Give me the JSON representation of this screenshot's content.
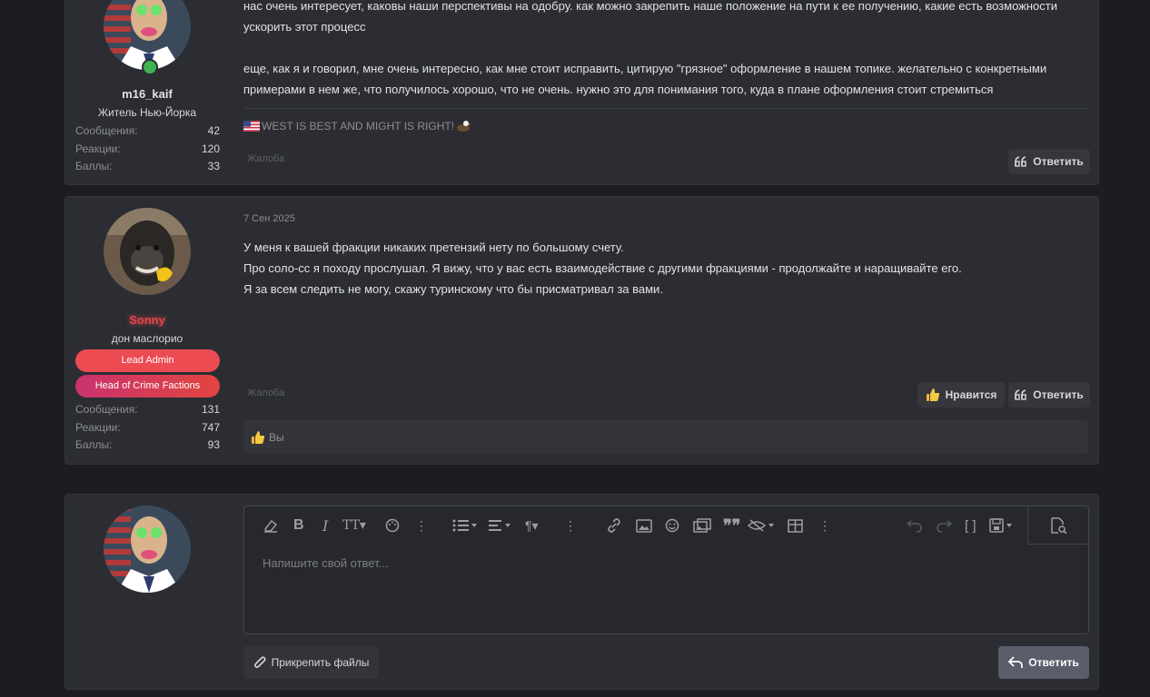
{
  "posts": [
    {
      "username": "m16_kaif",
      "user_title": "Житель Нью-Йорка",
      "stats": [
        {
          "label": "Сообщения:",
          "value": "42"
        },
        {
          "label": "Реакции:",
          "value": "120"
        },
        {
          "label": "Баллы:",
          "value": "33"
        }
      ],
      "lines": [
        "нас очень интересует, каковы наши перспективы на одобру. как можно закрепить наше положение на пути к ее получению, какие есть возможности",
        "ускорить этот процесс",
        "еще, как я и говорил, мне очень интересно, как мне стоит исправить, цитирую \"грязное\" оформление в нашем топике. желательно с конкретными",
        "примерами в нем же, что получилось хорошо, что не очень. нужно это для понимания того, куда в плане оформления стоит стремиться"
      ],
      "signature": "WEST IS BEST AND MIGHT IS RIGHT!",
      "report_label": "Жалоба",
      "reply_label": "Ответить"
    },
    {
      "date": "7 Сен 2025",
      "username": "Sonny",
      "user_title": "дон маслорио",
      "banners": [
        "Lead Admin",
        "Head of Crime Factions"
      ],
      "stats": [
        {
          "label": "Сообщения:",
          "value": "131"
        },
        {
          "label": "Реакции:",
          "value": "747"
        },
        {
          "label": "Баллы:",
          "value": "93"
        }
      ],
      "lines": [
        "У меня к вашей фракции никаких претензий нету по большому счету.",
        "Про соло-сс я походу прослушал. Я вижу, что у вас есть взаимодействие с другими фракциями - продолжайте и наращивайте его.",
        "Я за всем следить не могу, скажу туринскому что бы присматривал за вами."
      ],
      "report_label": "Жалоба",
      "like_label": "Нравится",
      "reply_label": "Ответить",
      "reactions_text": "Вы"
    }
  ],
  "editor": {
    "placeholder": "Напишите свой ответ...",
    "attach_label": "Прикрепить файлы",
    "submit_label": "Ответить"
  },
  "colors": {
    "sonny_name": "#e0454c",
    "lead_admin": "#ec4b52",
    "head_crime": "#d63a5e",
    "online": "#3fb34f"
  }
}
